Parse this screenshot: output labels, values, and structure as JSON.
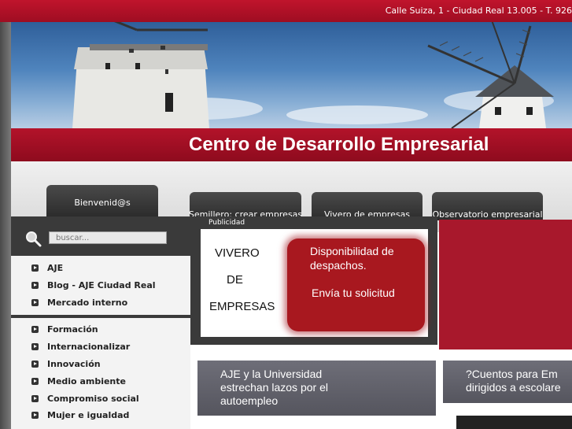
{
  "header": {
    "address": "Calle Suiza, 1 - Ciudad Real 13.005 - T. 926",
    "site_title": "Centro de Desarrollo Empresarial"
  },
  "tabs": {
    "welcome": "Bienvenid@s",
    "semillero": "Semillero: crear empresas",
    "vivero": "Vivero de empresas",
    "observatorio": "Observatorio empresarial"
  },
  "search": {
    "placeholder": "buscar..."
  },
  "menu_group_1": [
    {
      "label": "AJE"
    },
    {
      "label": "Blog - AJE Ciudad Real"
    },
    {
      "label": "Mercado interno"
    }
  ],
  "menu_group_2": [
    {
      "label": "Formación"
    },
    {
      "label": "Internacionalizar"
    },
    {
      "label": "Innovación"
    },
    {
      "label": "Medio ambiente"
    },
    {
      "label": "Compromiso social"
    },
    {
      "label": "Mujer e igualdad"
    }
  ],
  "publicidad": {
    "label": "Publicidad",
    "vivero_line1": "VIVERO",
    "vivero_line2": "DE",
    "vivero_line3": "EMPRESAS",
    "promo_line1": "Disponibilidad de",
    "promo_line2": "despachos.",
    "promo_cta": "Envía tu solicitud"
  },
  "news": [
    {
      "title_line1": "AJE y la Universidad",
      "title_line2": "estrechan lazos por el",
      "title_line3": "autoempleo"
    },
    {
      "title_line1": "?Cuentos para Em",
      "title_line2": "dirigidos a escolare"
    }
  ],
  "colors": {
    "brand_red": "#b3132a",
    "dark_grey": "#3a3a3a"
  }
}
